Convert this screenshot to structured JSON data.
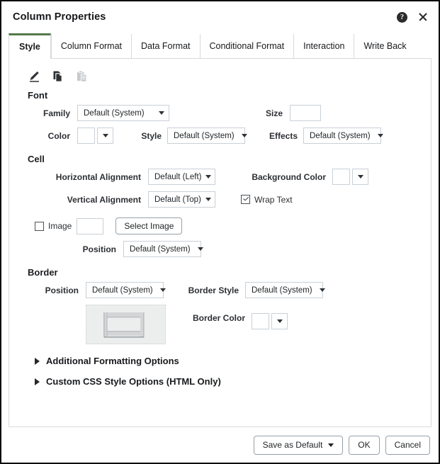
{
  "dialog": {
    "title": "Column Properties",
    "help_icon": "help-circle-icon",
    "close_icon": "close-icon"
  },
  "tabs": [
    {
      "label": "Style",
      "active": true
    },
    {
      "label": "Column Format",
      "active": false
    },
    {
      "label": "Data Format",
      "active": false
    },
    {
      "label": "Conditional Format",
      "active": false
    },
    {
      "label": "Interaction",
      "active": false
    },
    {
      "label": "Write Back",
      "active": false
    }
  ],
  "toolbar": {
    "format_painter_icon": "format-painter-icon",
    "copy_icon": "copy-icon",
    "paste_icon": "paste-icon"
  },
  "font": {
    "heading": "Font",
    "family_label": "Family",
    "family_value": "Default (System)",
    "size_label": "Size",
    "size_value": "",
    "color_label": "Color",
    "color_value": "#ffffff",
    "style_label": "Style",
    "style_value": "Default (System)",
    "effects_label": "Effects",
    "effects_value": "Default (System)"
  },
  "cell": {
    "heading": "Cell",
    "horizontal_alignment_label": "Horizontal Alignment",
    "horizontal_alignment_value": "Default (Left)",
    "vertical_alignment_label": "Vertical Alignment",
    "vertical_alignment_value": "Default (Top)",
    "background_color_label": "Background Color",
    "background_color_value": "#ffffff",
    "wrap_text_label": "Wrap Text",
    "wrap_text_checked": true,
    "image_label": "Image",
    "image_checked": false,
    "image_value": "",
    "select_image_label": "Select Image",
    "position_label": "Position",
    "position_value": "Default (System)"
  },
  "border": {
    "heading": "Border",
    "position_label": "Position",
    "position_value": "Default (System)",
    "border_style_label": "Border Style",
    "border_style_value": "Default (System)",
    "border_color_label": "Border Color",
    "border_color_value": "#ffffff",
    "preview_name": "border-preview"
  },
  "sections": [
    {
      "label": "Additional Formatting Options",
      "expanded": false
    },
    {
      "label": "Custom CSS Style Options (HTML Only)",
      "expanded": false
    }
  ],
  "footer": {
    "save_as_default_label": "Save as Default",
    "ok_label": "OK",
    "cancel_label": "Cancel"
  },
  "colors": {
    "accent_green": "#55794a",
    "dialog_border": "#0d0d0d",
    "field_border": "#c9d0d6",
    "panel_border": "#d6dadd",
    "preview_bg": "#eceded"
  }
}
